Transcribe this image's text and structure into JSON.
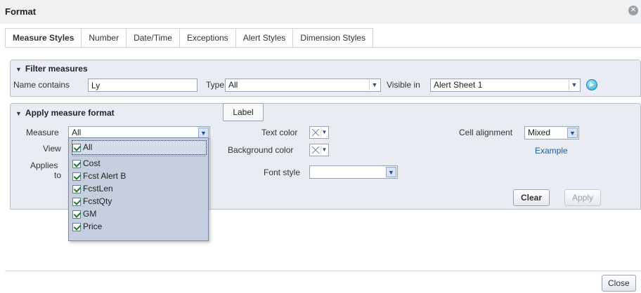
{
  "dialog": {
    "title": "Format",
    "close_glyph": "✕",
    "close_label": "Close"
  },
  "tabs": [
    "Measure Styles",
    "Number",
    "Date/Time",
    "Exceptions",
    "Alert Styles",
    "Dimension Styles"
  ],
  "active_tab": "Measure Styles",
  "filter": {
    "title": "Filter measures",
    "name_contains_label": "Name contains",
    "name_contains_value": "Ly",
    "type_label": "Type",
    "type_value": "All",
    "visible_in_label": "Visible in",
    "visible_in_value": "Alert Sheet 1"
  },
  "apply": {
    "title": "Apply measure format",
    "measure_label": "Measure",
    "measure_value": "All",
    "view_label": "View",
    "applies_label_1": "Applies",
    "applies_label_2": "to",
    "text_color_label": "Text color",
    "background_color_label": "Background color",
    "font_style_label": "Font style",
    "font_style_value": "",
    "cell_alignment_label": "Cell alignment",
    "cell_alignment_value": "Mixed",
    "example_link": "Example",
    "clear_button": "Clear",
    "apply_button": "Apply"
  },
  "tooltip": {
    "text": "Label"
  },
  "measure_options": [
    {
      "label": "All",
      "checked": true
    },
    {
      "label": "Cost",
      "checked": true
    },
    {
      "label": "Fcst Alert B",
      "checked": true
    },
    {
      "label": "FcstLen",
      "checked": true
    },
    {
      "label": "FcstQty",
      "checked": true
    },
    {
      "label": "GM",
      "checked": true
    },
    {
      "label": "Price",
      "checked": true
    }
  ],
  "colors": {
    "section_bg": "#e9ecf3",
    "list_bg": "#c6cfe0",
    "link": "#1e5a9a"
  },
  "icons": [
    "expand-triangle-icon",
    "dropdown-arrow-icon",
    "go-arrow-icon",
    "no-color-x-icon",
    "checkbox-checked-icon",
    "dialog-close-icon"
  ]
}
